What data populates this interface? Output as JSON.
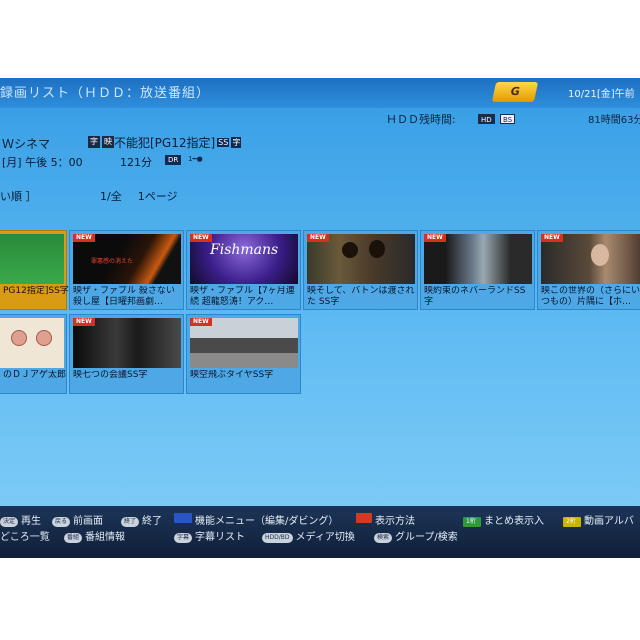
{
  "header": {
    "title": "録画リスト（ＨＤＤ：放送番組）",
    "logo_text": "G",
    "date": "10/21[金]午前"
  },
  "hdd": {
    "label": "ＨＤＤ残時間:",
    "badge1": "HD",
    "badge2": "BS",
    "remaining": "81時間63分"
  },
  "selected": {
    "channel": "Ｗシネマ",
    "channel_icon": "字",
    "program_icon": "映",
    "program": "不能犯[PG12指定]",
    "program_tags": [
      "SS",
      "字"
    ],
    "datetime": "[月]  午後 5：00",
    "duration": "121分",
    "dr": "DR",
    "dr_extra": "1━●"
  },
  "list": {
    "sort": "い順  ］",
    "page": "1/全",
    "pages": "1ページ"
  },
  "tiles": [
    {
      "title": "PG12指定]SS字",
      "new": "",
      "thumb": "green"
    },
    {
      "title": "映ザ・ファブル  殺さない殺し屋【日曜邦画劇…",
      "new": "NEW",
      "thumb": "dark-red-text"
    },
    {
      "title": "映ザ・ファブル【7ヶ月連続  超龍怒涛！アク…",
      "new": "NEW",
      "thumb": "stage"
    },
    {
      "title": "映そして、バトンは渡された SS字",
      "new": "NEW",
      "thumb": "people"
    },
    {
      "title": "映約束のネバーランドSS字",
      "new": "NEW",
      "thumb": "interior"
    },
    {
      "title": "映この世界の（さらにいくつもの）片隅に【ホ…",
      "new": "NEW",
      "thumb": "portrait"
    },
    {
      "title": "のＤＪアゲ太郎",
      "new": "",
      "thumb": "cartoon"
    },
    {
      "title": "映七つの会議SS字",
      "new": "NEW",
      "thumb": "meeting"
    },
    {
      "title": "映空飛ぶタイヤSS字",
      "new": "NEW",
      "thumb": "street"
    }
  ],
  "hints": {
    "row1": [
      {
        "key": "決定",
        "label": "再生"
      },
      {
        "key": "戻る",
        "label": "前画面"
      },
      {
        "key": "終了",
        "label": "終了"
      },
      {
        "key": "",
        "label": "機能メニュー（編集/ダビング）"
      },
      {
        "key": "",
        "label": "表示方法"
      },
      {
        "key": "1桁",
        "label": "まとめ表示入"
      },
      {
        "key": "2桁",
        "label": "動画アルバ"
      }
    ],
    "row2": [
      {
        "key": "",
        "label": "どころ一覧"
      },
      {
        "key": "番組情報",
        "label": "番組情報"
      },
      {
        "key": "字幕",
        "label": "字幕リスト"
      },
      {
        "key": "HDD/BD",
        "label": "メディア切換"
      },
      {
        "key": "検索",
        "label": "グループ/検索"
      }
    ]
  },
  "colors": {
    "panel": "#62bdf3",
    "topbar": "#1d6fc2",
    "focus": "#d99a14",
    "new_badge": "#d6301e"
  }
}
